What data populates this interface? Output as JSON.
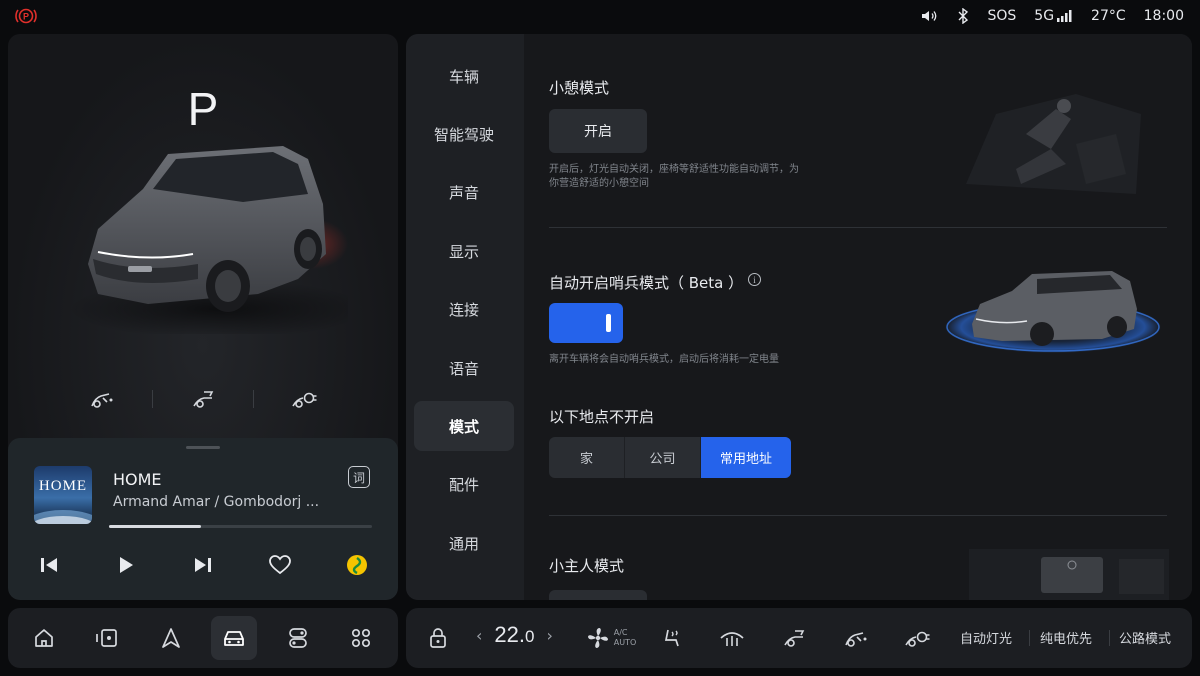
{
  "status": {
    "sos": "SOS",
    "network": "5G",
    "temperature": "27°C",
    "time": "18:00",
    "icons": [
      "parking-brake-icon",
      "volume-icon",
      "bluetooth-icon",
      "signal-icon"
    ]
  },
  "vehicle": {
    "gear": "P",
    "quick_controls": [
      "front-trunk-icon",
      "rear-trunk-icon",
      "charge-port-icon"
    ]
  },
  "media": {
    "album_text": "HOME",
    "title": "HOME",
    "artist": "Armand Amar / Gombodorj ...",
    "lyric_button": "词",
    "progress": 0.35
  },
  "dock_left": {
    "items": [
      "home-icon",
      "media-icon",
      "navigation-icon",
      "vehicle-icon",
      "switch-icon",
      "apps-icon"
    ],
    "active": "vehicle-icon"
  },
  "settings": {
    "nav": [
      "车辆",
      "智能驾驶",
      "声音",
      "显示",
      "连接",
      "语音",
      "模式",
      "配件",
      "通用"
    ],
    "active_nav": "模式",
    "nap_mode": {
      "title": "小憩模式",
      "button": "开启",
      "description_line1": "开启后，灯光自动关闭，座椅等舒适性功能自动调节，为",
      "description_line2": "你营造舒适的小憩空间"
    },
    "sentry_mode": {
      "title": "自动开启哨兵模式（ Beta ）",
      "info": "i",
      "enabled": true,
      "description": "离开车辆将会自动哨兵模式，启动后将消耗一定电量"
    },
    "exclude_locations": {
      "title": "以下地点不开启",
      "options": [
        "家",
        "公司",
        "常用地址"
      ],
      "selected": "常用地址"
    },
    "kid_mode": {
      "title": "小主人模式"
    }
  },
  "climate": {
    "temperature": "22.",
    "temperature_decimal": "0",
    "ac_label_top": "A/C",
    "ac_label_bottom": "AUTO",
    "buttons": [
      "自动灯光",
      "纯电优先",
      "公路模式"
    ]
  },
  "colors": {
    "accent": "#2563eb",
    "park_brake": "#e0302b",
    "panel": "#1c1e22"
  }
}
